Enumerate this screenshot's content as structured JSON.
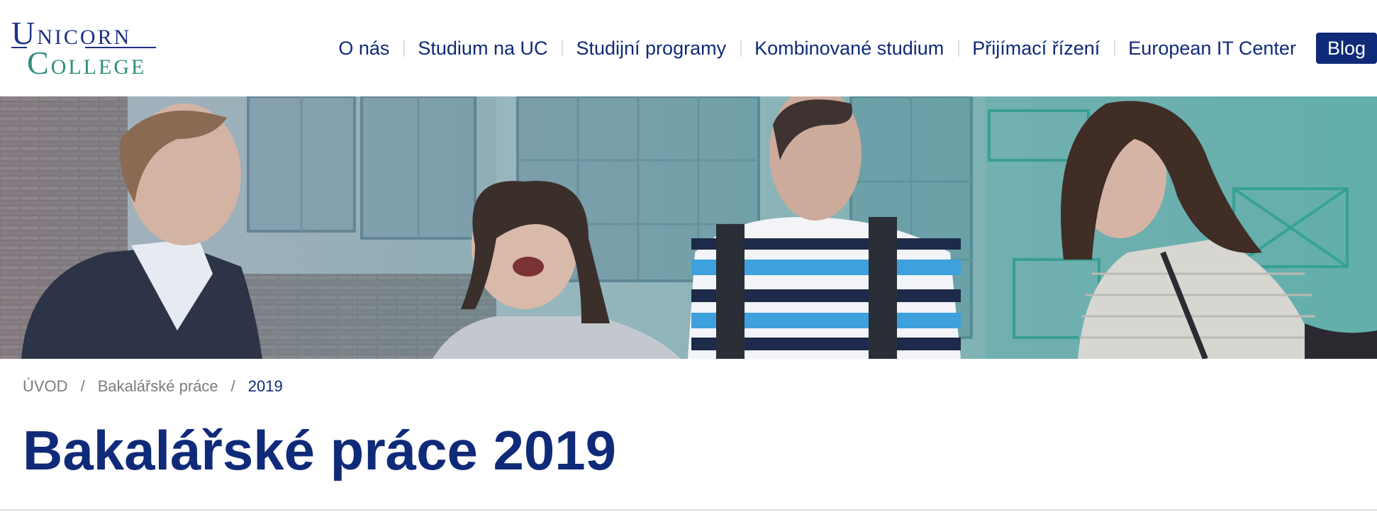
{
  "brand": {
    "logo_line1": "UNICORN",
    "logo_line2": "COLLEGE",
    "logo_line1_initial": "U",
    "logo_line1_rest": "NICORN",
    "logo_line2_initial": "C",
    "logo_line2_rest": "OLLEGE",
    "primary_color": "#0f2a78",
    "accent_color": "#2f8d7e"
  },
  "nav": {
    "items": [
      {
        "label": "O nás"
      },
      {
        "label": "Studium na UC"
      },
      {
        "label": "Studijní programy"
      },
      {
        "label": "Kombinované studium"
      },
      {
        "label": "Přijímací řízení"
      },
      {
        "label": "European IT Center"
      }
    ],
    "blog_label": "Blog"
  },
  "hero": {
    "image_name": "students-group-photo"
  },
  "breadcrumb": {
    "items": [
      {
        "label": "ÚVOD"
      },
      {
        "label": "Bakalářské práce"
      }
    ],
    "separator": "/",
    "current": "2019"
  },
  "page": {
    "title": "Bakalářské práce 2019"
  }
}
